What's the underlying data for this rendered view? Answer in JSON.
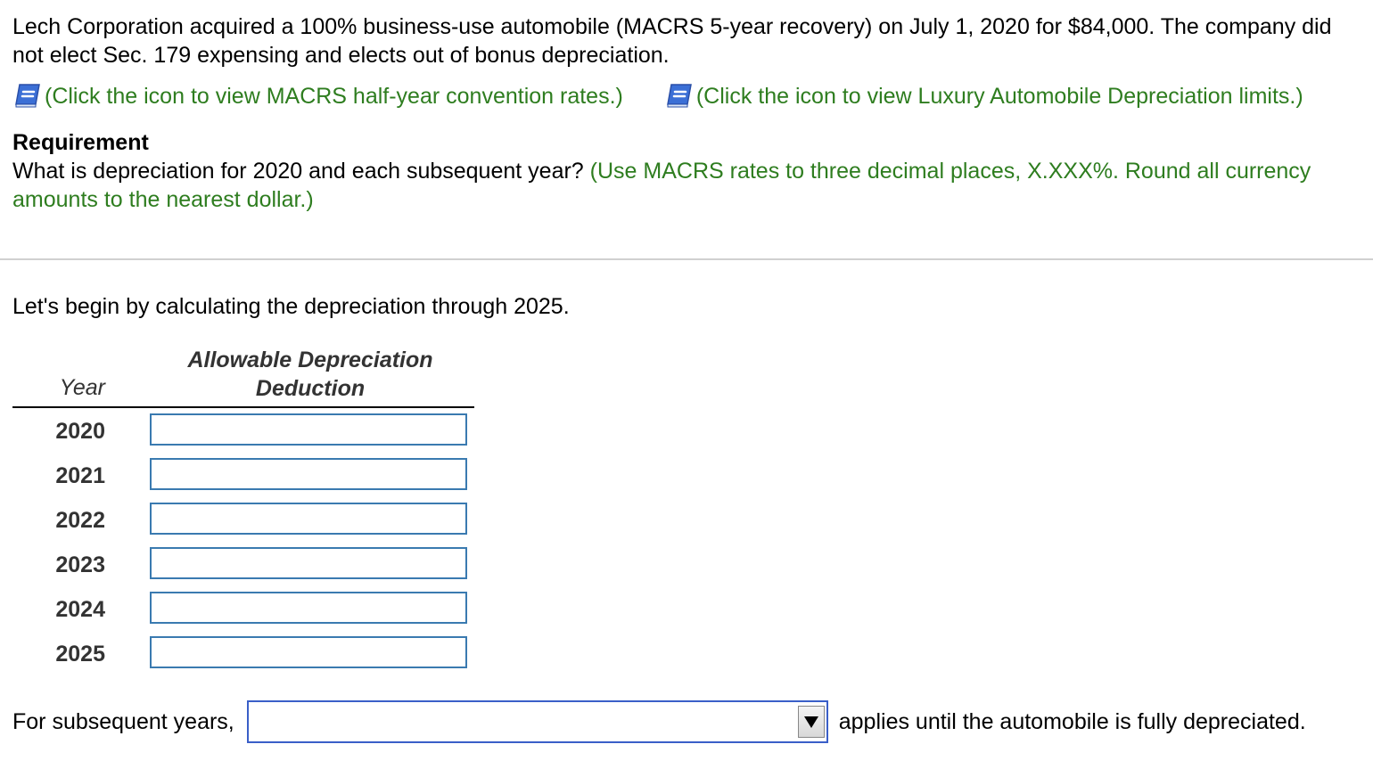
{
  "problem": {
    "statement": "Lech Corporation acquired a 100% business-use automobile (MACRS 5-year recovery) on July 1, 2020 for $84,000. The company did not elect Sec. 179 expensing and elects out of bonus depreciation.",
    "link_rates": "(Click the icon to view MACRS half-year convention rates.)",
    "link_limits": "(Click the icon to view Luxury Automobile Depreciation limits.)",
    "requirement_heading": "Requirement",
    "requirement_question": "What is depreciation for 2020 and each subsequent year?",
    "requirement_instruction": "(Use MACRS rates to three decimal places, X.XXX%. Round all currency amounts to the nearest dollar.)"
  },
  "intro": "Let's begin by calculating the depreciation through 2025.",
  "table": {
    "col_year": "Year",
    "col_dep_line1": "Allowable Depreciation",
    "col_dep_line2": "Deduction",
    "rows": [
      {
        "year": "2020",
        "value": ""
      },
      {
        "year": "2021",
        "value": ""
      },
      {
        "year": "2022",
        "value": ""
      },
      {
        "year": "2023",
        "value": ""
      },
      {
        "year": "2024",
        "value": ""
      },
      {
        "year": "2025",
        "value": ""
      }
    ]
  },
  "subsequent": {
    "prefix": "For subsequent years,",
    "selected": "",
    "suffix": "applies until the automobile is fully depreciated."
  },
  "colors": {
    "link_green": "#2e7d1f",
    "input_border": "#3a7ab0",
    "dropdown_border": "#3a5fc8",
    "icon_blue": "#3b6fd6"
  },
  "icons": {
    "rates": "book-icon",
    "limits": "book-icon",
    "dropdown": "triangle-down-icon"
  }
}
